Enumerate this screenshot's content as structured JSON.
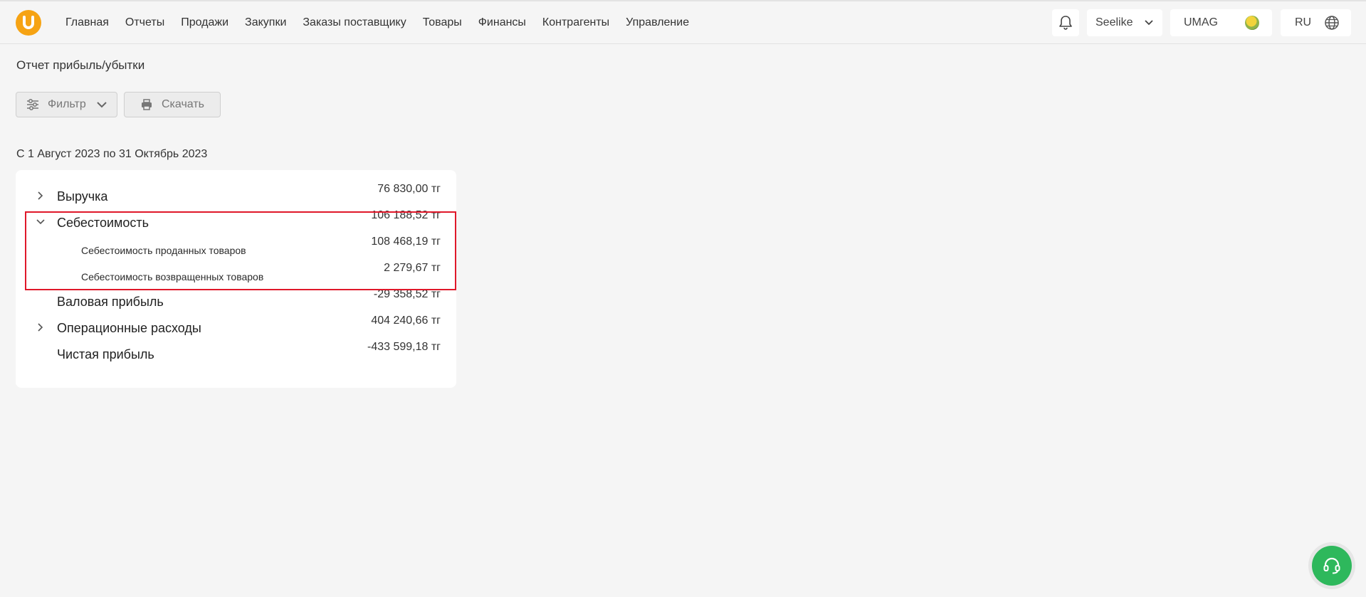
{
  "brand": {
    "logo_letter": "U",
    "color": "#f6a313"
  },
  "nav": {
    "items": [
      {
        "label": "Главная"
      },
      {
        "label": "Отчеты"
      },
      {
        "label": "Продажи"
      },
      {
        "label": "Закупки"
      },
      {
        "label": "Заказы поставщику"
      },
      {
        "label": "Товары"
      },
      {
        "label": "Финансы"
      },
      {
        "label": "Контрагенты"
      },
      {
        "label": "Управление"
      }
    ]
  },
  "header": {
    "notifications_icon": "bell-icon",
    "company": "Seelike",
    "store": "UMAG",
    "language": "RU"
  },
  "page": {
    "title": "Отчет прибыль/убытки",
    "filter_label": "Фильтр",
    "download_label": "Скачать",
    "period": "С 1 Август 2023 по 31 Октябрь 2023"
  },
  "report": {
    "rows": [
      {
        "label": "Выручка",
        "amount": "76 830,00 тг",
        "expandable": true,
        "expanded": false
      },
      {
        "label": "Себестоимость",
        "amount": "106 188,52 тг",
        "expandable": true,
        "expanded": true
      },
      {
        "label": "Себестоимость проданных товаров",
        "amount": "108 468,19 тг",
        "sub": true
      },
      {
        "label": "Себестоимость возвращенных товаров",
        "amount": "2 279,67 тг",
        "sub": true
      },
      {
        "label": "Валовая прибыль",
        "amount": "-29 358,52 тг"
      },
      {
        "label": "Операционные расходы",
        "amount": "404 240,66 тг",
        "expandable": true,
        "expanded": false
      },
      {
        "label": "Чистая прибыль",
        "amount": "-433 599,18 тг"
      }
    ]
  },
  "colors": {
    "highlight": "#e0182a",
    "support": "#2eb85c"
  }
}
